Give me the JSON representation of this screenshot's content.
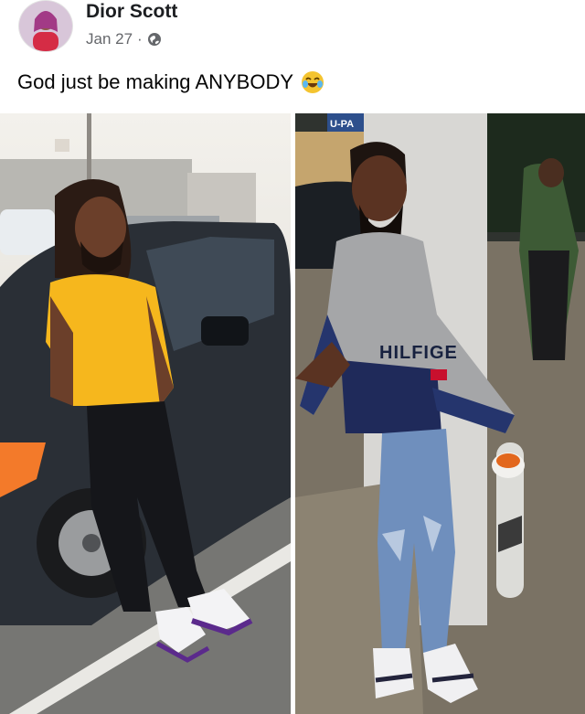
{
  "post": {
    "author": "Dior Scott",
    "date": "Jan 27",
    "separator": "·",
    "privacy_icon": "globe-icon",
    "text": "God just be making ANYBODY",
    "emoji": "laughing-tears-emoji"
  },
  "photos": {
    "right_sweater_text": "HILFIGE",
    "right_sign_text": "U-PA"
  },
  "colors": {
    "author": "#1c1e21",
    "meta": "#65676b",
    "yellow_shirt": "#f6b71d",
    "car": "#2a2f36"
  }
}
